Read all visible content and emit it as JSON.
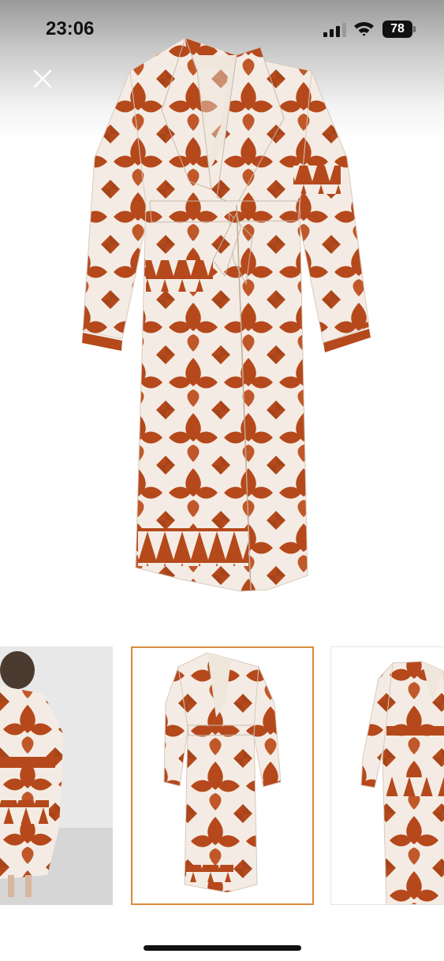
{
  "status_bar": {
    "time": "23:06",
    "battery_level": "78",
    "signal_icon": "cellular-signal-icon",
    "wifi_icon": "wifi-icon"
  },
  "controls": {
    "close_icon": "close-icon"
  },
  "gallery": {
    "selected_index": 1,
    "accent_color": "#d98a3d",
    "pattern_colors": {
      "rust": "#b5491c",
      "cream": "#f4ece4"
    },
    "thumbnails": [
      {
        "name": "model-back-view"
      },
      {
        "name": "robe-front-view"
      },
      {
        "name": "robe-side-view"
      }
    ]
  }
}
